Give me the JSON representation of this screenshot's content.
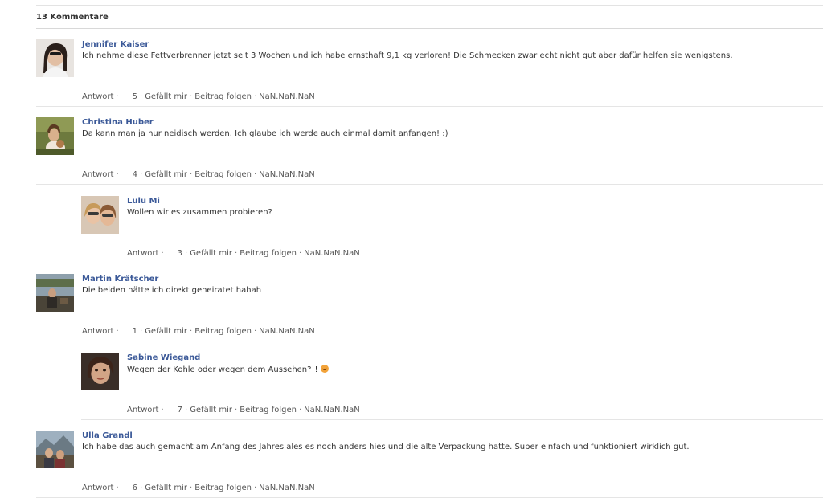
{
  "header": {
    "count_label": "13 Kommentare"
  },
  "comments": [
    {
      "author": "Jennifer Kaiser",
      "text": "Ich nehme diese Fettverbrenner jetzt seit 3 Wochen und ich habe ernsthaft 9,1 kg verloren! Die Schmecken zwar echt nicht gut aber dafür helfen sie wenigstens.",
      "reply_label": "Antwort",
      "likes": "5",
      "like_label": "Gefällt mir",
      "follow_label": "Beitrag folgen",
      "date": "NaN.NaN.NaN"
    },
    {
      "author": "Christina Huber",
      "text": "Da kann man ja nur neidisch werden. Ich glaube ich werde auch einmal damit anfangen! :)",
      "reply_label": "Antwort",
      "likes": "4",
      "like_label": "Gefällt mir",
      "follow_label": "Beitrag folgen",
      "date": "NaN.NaN.NaN"
    },
    {
      "author": "Lulu Mi",
      "text": "Wollen wir es zusammen probieren?",
      "reply_label": "Antwort",
      "likes": "3",
      "like_label": "Gefällt mir",
      "follow_label": "Beitrag folgen",
      "date": "NaN.NaN.NaN"
    },
    {
      "author": "Martin Krätscher",
      "text": "Die beiden hätte ich direkt geheiratet hahah",
      "reply_label": "Antwort",
      "likes": "1",
      "like_label": "Gefällt mir",
      "follow_label": "Beitrag folgen",
      "date": "NaN.NaN.NaN"
    },
    {
      "author": "Sabine Wiegand",
      "text": "Wegen der Kohle oder wegen dem Aussehen?!!",
      "emoji": "grinning-face-emoji",
      "reply_label": "Antwort",
      "likes": "7",
      "like_label": "Gefällt mir",
      "follow_label": "Beitrag folgen",
      "date": "NaN.NaN.NaN"
    },
    {
      "author": "Ulla Grandl",
      "text": "Ich habe das auch gemacht am Anfang des Jahres ales es noch anders hies und die alte Verpackung hatte. Super einfach und funktioniert wirklich gut.",
      "reply_label": "Antwort",
      "likes": "6",
      "like_label": "Gefällt mir",
      "follow_label": "Beitrag folgen",
      "date": "NaN.NaN.NaN"
    }
  ],
  "colors": {
    "author_link": "#3b5998",
    "body_text": "#333333",
    "separator": "#e5e5e5"
  }
}
